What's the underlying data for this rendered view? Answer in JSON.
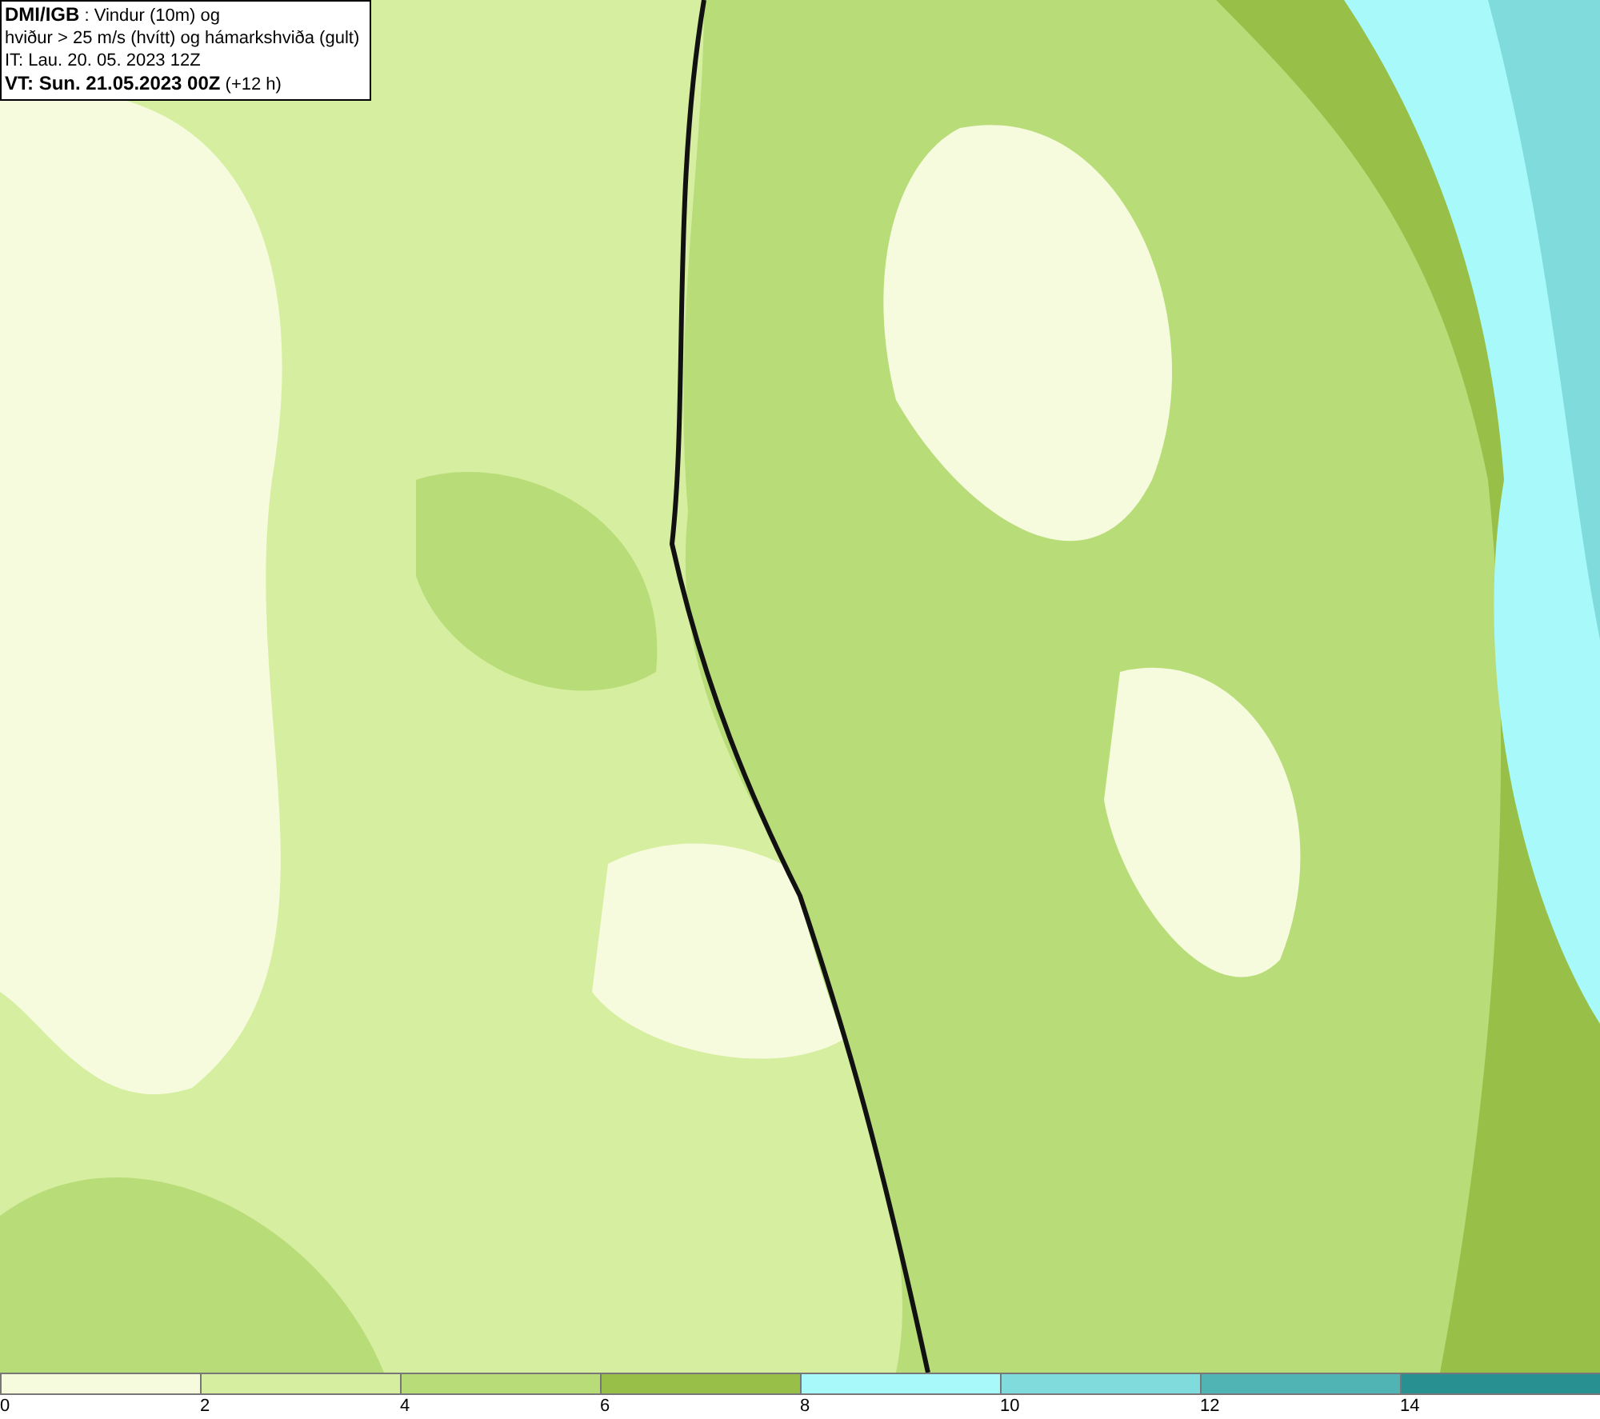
{
  "info_box": {
    "lines": [
      "**DMI/IGB** : Vindur (10m) og",
      "hviður > 25 m/s (hvítt) og hámarkshviða (gult)",
      "IT: Lau. 20. 05. 2023 12Z",
      "**VT: Sun. 21.05.2023 00Z** (+12 h)"
    ]
  },
  "legend": {
    "segments": [
      {
        "color": "#f5fbdc"
      },
      {
        "color": "#d6eea0"
      },
      {
        "color": "#b8dc78"
      },
      {
        "color": "#98c048"
      },
      {
        "color": "#a8fafa"
      },
      {
        "color": "#80dcdc"
      },
      {
        "color": "#50b4b4"
      },
      {
        "color": "#289090"
      }
    ],
    "ticks": [
      "0",
      "2",
      "4",
      "6",
      "8",
      "10",
      "12",
      "14"
    ]
  }
}
